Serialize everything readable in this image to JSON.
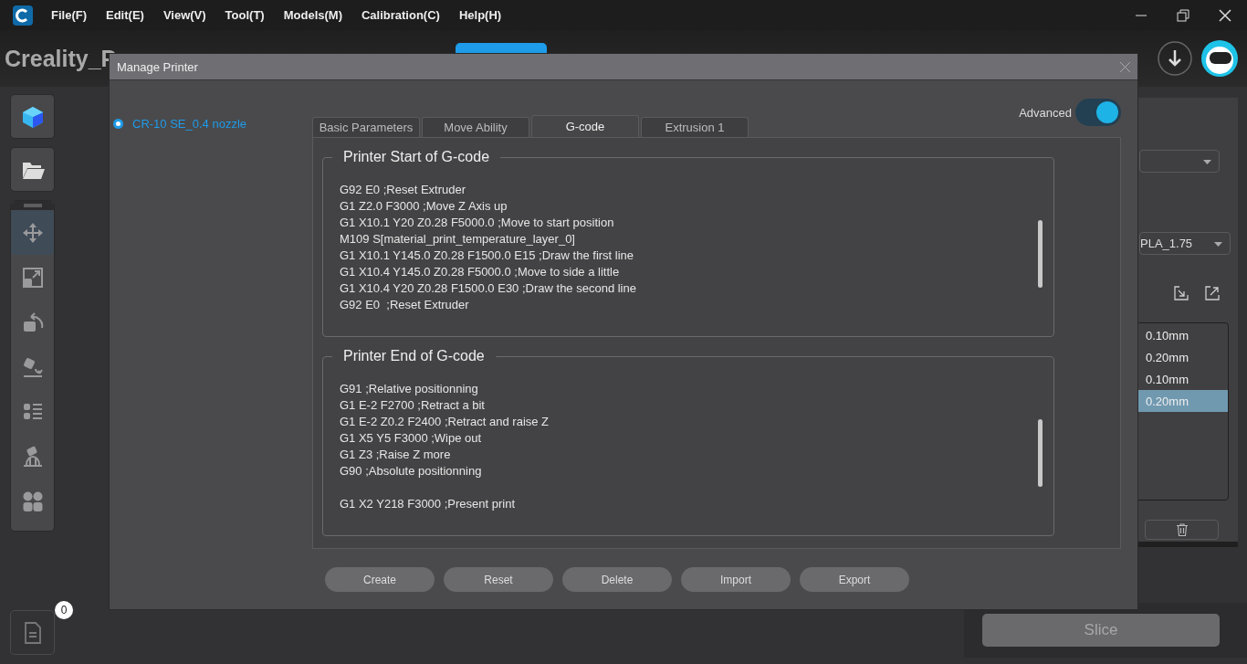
{
  "menu": [
    "File(F)",
    "Edit(E)",
    "View(V)",
    "Tool(T)",
    "Models(M)",
    "Calibration(C)",
    "Help(H)"
  ],
  "app_title": "Creality_P",
  "tools": [
    {
      "kind": "move",
      "selected": true
    },
    {
      "kind": "scale",
      "selected": false
    },
    {
      "kind": "rotate",
      "selected": false
    },
    {
      "kind": "lay",
      "selected": false
    },
    {
      "kind": "list",
      "selected": false
    },
    {
      "kind": "support",
      "selected": false
    },
    {
      "kind": "arrange",
      "selected": false
    }
  ],
  "file_badge": "0",
  "right_panel": {
    "material": "PLA_1.75",
    "layer_heights": [
      {
        "label": "0.10mm",
        "selected": false
      },
      {
        "label": "0.20mm",
        "selected": false
      },
      {
        "label": "0.10mm",
        "selected": false
      },
      {
        "label": "0.20mm",
        "selected": true
      }
    ]
  },
  "slice_button": {
    "label": "Slice",
    "disabled": true
  },
  "dialog": {
    "title": "Manage Printer",
    "printers": [
      {
        "name": "CR-10 SE_0.4 nozzle",
        "selected": true
      }
    ],
    "advanced": {
      "label": "Advanced",
      "on": true
    },
    "tabs": [
      {
        "label": "Basic Parameters",
        "selected": false
      },
      {
        "label": "Move Ability",
        "selected": false
      },
      {
        "label": "G-code",
        "selected": true
      },
      {
        "label": "Extrusion 1",
        "selected": false
      }
    ],
    "groups": [
      {
        "title": "Printer Start of G-code",
        "blocks": [
          [
            "G92 E0 ;Reset Extruder",
            "G1 Z2.0 F3000 ;Move Z Axis up",
            "G1 X10.1 Y20 Z0.28 F5000.0 ;Move to start position",
            "M109 S[material_print_temperature_layer_0]",
            "G1 X10.1 Y145.0 Z0.28 F1500.0 E15 ;Draw the first line",
            "G1 X10.4 Y145.0 Z0.28 F5000.0 ;Move to side a little",
            "G1 X10.4 Y20 Z0.28 F1500.0 E30 ;Draw the second line",
            "G92 E0  ;Reset Extruder"
          ]
        ]
      },
      {
        "title": "Printer End of G-code",
        "blocks": [
          [
            "G91 ;Relative positionning",
            "G1 E-2 F2700 ;Retract a bit",
            "G1 E-2 Z0.2 F2400 ;Retract and raise Z",
            "G1 X5 Y5 F3000 ;Wipe out",
            "G1 Z3 ;Raise Z more",
            "G90 ;Absolute positionning"
          ],
          [
            "G1 X2 Y218 F3000 ;Present print"
          ]
        ]
      }
    ],
    "buttons": [
      "Create",
      "Reset",
      "Delete",
      "Import",
      "Export"
    ]
  }
}
